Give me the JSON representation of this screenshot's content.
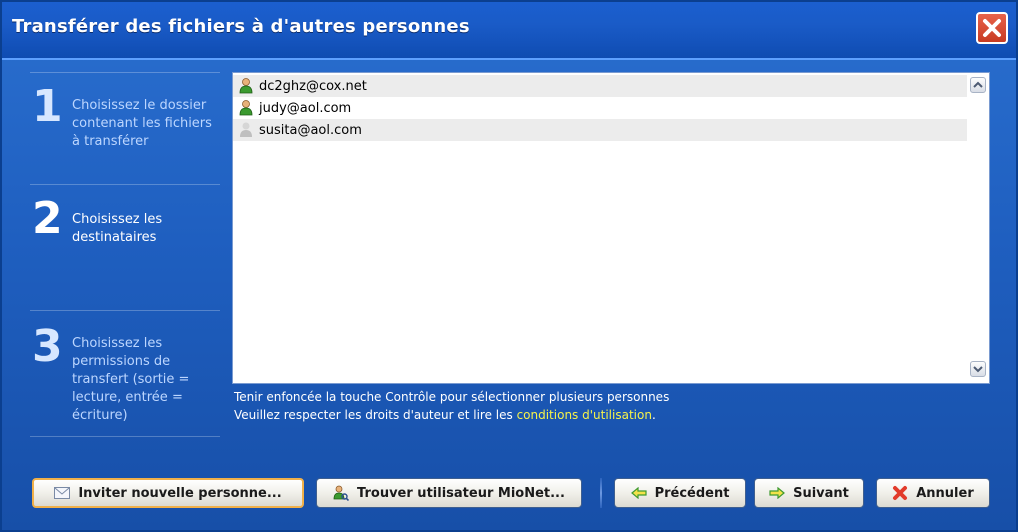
{
  "window": {
    "title": "Transférer des fichiers à d'autres personnes"
  },
  "steps": [
    {
      "number": "1",
      "label": "Choisissez le dossier contenant les fichiers à transférer"
    },
    {
      "number": "2",
      "label": "Choisissez les destinataires"
    },
    {
      "number": "3",
      "label": "Choisissez les permissions de transfert (sortie = lecture, entrée = écriture)"
    }
  ],
  "recipients": [
    {
      "email": "dc2ghz@cox.net",
      "status": "online"
    },
    {
      "email": "judy@aol.com",
      "status": "online"
    },
    {
      "email": "susita@aol.com",
      "status": "offline"
    }
  ],
  "hints": {
    "multi_select": "Tenir enfoncée la touche Contrôle pour sélectionner plusieurs personnes",
    "copyright_prefix": "Veuillez respecter les droits d'auteur et lire les ",
    "copyright_link": "conditions d'utilisation",
    "copyright_suffix": "."
  },
  "buttons": {
    "invite": "Inviter nouvelle personne...",
    "find_user": "Trouver utilisateur MioNet...",
    "previous": "Précédent",
    "next": "Suivant",
    "cancel": "Annuler"
  },
  "colors": {
    "accent_link": "#f6f34a",
    "online_user": "#3b9a2f",
    "offline_user": "#bfbfbf"
  }
}
